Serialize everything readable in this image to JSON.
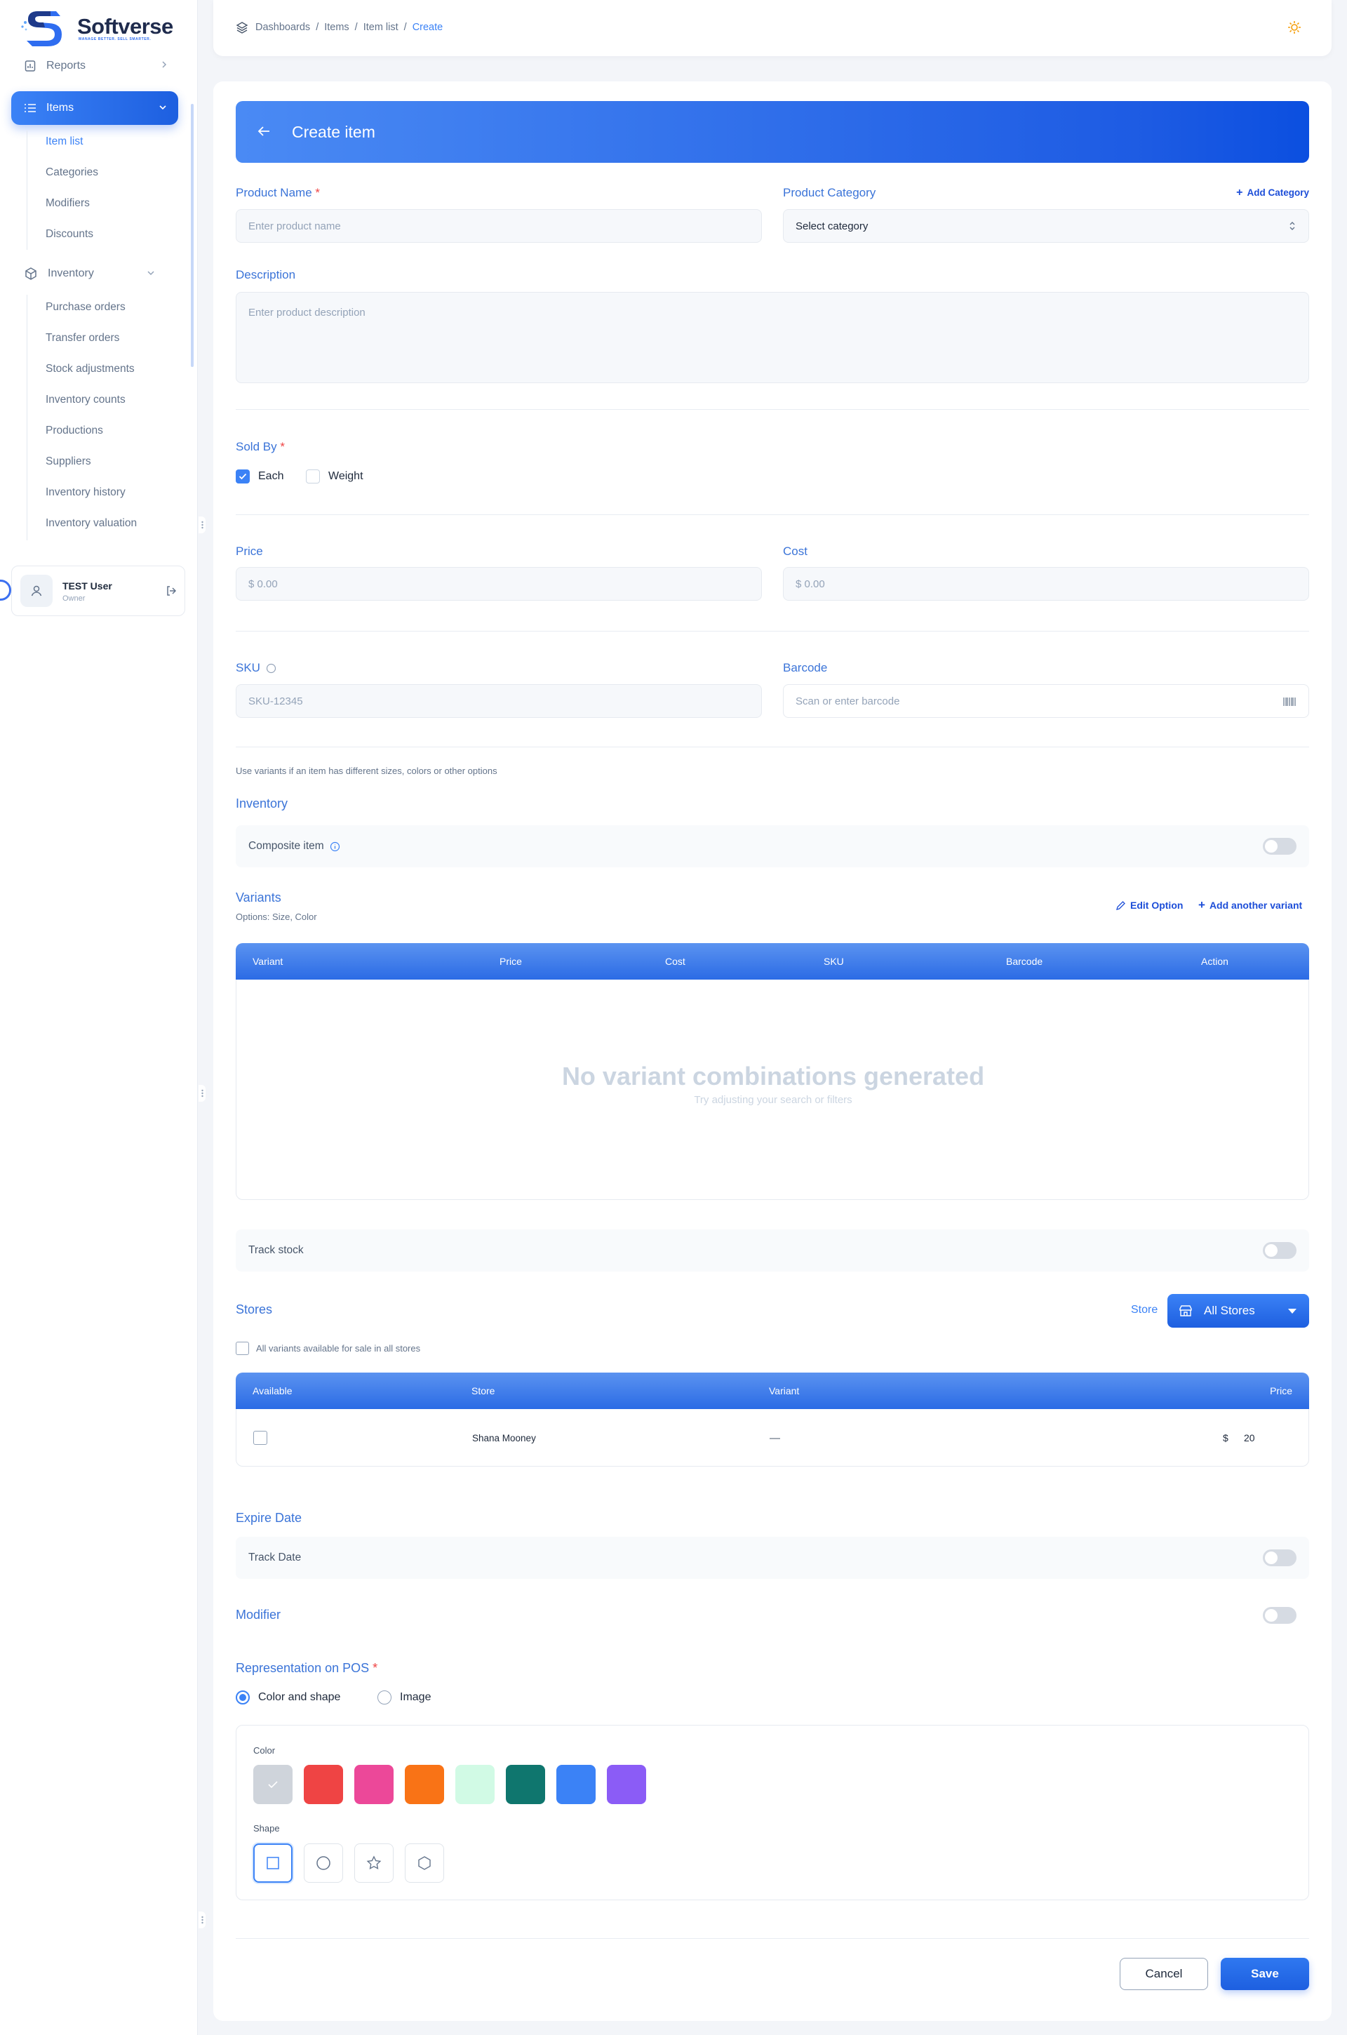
{
  "brand": {
    "name": "Softverse",
    "tagline": "MANAGE BETTER. SELL SMARTER."
  },
  "sidebar": {
    "reports": "Reports",
    "items": "Items",
    "items_sub": [
      "Item list",
      "Categories",
      "Modifiers",
      "Discounts"
    ],
    "inventory": "Inventory",
    "inventory_sub": [
      "Purchase orders",
      "Transfer orders",
      "Stock adjustments",
      "Inventory counts",
      "Productions",
      "Suppliers",
      "Inventory history",
      "Inventory valuation"
    ],
    "user": {
      "name": "TEST User",
      "role": "Owner"
    }
  },
  "breadcrumb": [
    "Dashboards",
    "Items",
    "Item list",
    "Create"
  ],
  "page_title": "Create item",
  "form": {
    "product_name": {
      "label": "Product Name",
      "placeholder": "Enter product name"
    },
    "product_category": {
      "label": "Product Category",
      "value": "Select category",
      "add_link": "Add Category"
    },
    "description": {
      "label": "Description",
      "placeholder": "Enter product description"
    },
    "sold_by": {
      "label": "Sold By",
      "each": "Each",
      "weight": "Weight",
      "each_checked": true,
      "weight_checked": false
    },
    "price": {
      "label": "Price",
      "placeholder": "$ 0.00"
    },
    "cost": {
      "label": "Cost",
      "placeholder": "$ 0.00"
    },
    "sku": {
      "label": "SKU",
      "placeholder": "SKU-12345"
    },
    "barcode": {
      "label": "Barcode",
      "placeholder": "Scan or enter barcode"
    },
    "variants_hint": "Use variants if an item has different sizes, colors or other options",
    "inventory_title": "Inventory",
    "composite_item": "Composite item",
    "variants": {
      "title": "Variants",
      "options": "Options: Size, Color",
      "edit_option": "Edit Option",
      "add_variant": "Add another variant",
      "columns": [
        "Variant",
        "Price",
        "Cost",
        "SKU",
        "Barcode",
        "Action"
      ],
      "empty_title": "No variant combinations generated",
      "empty_sub": "Try adjusting your search or filters"
    },
    "track_stock": "Track stock",
    "stores": {
      "title": "Stores",
      "store_label": "Store",
      "store_button": "All Stores",
      "all_available": "All variants available for sale in all stores",
      "columns": [
        "Available",
        "Store",
        "Variant",
        "Price"
      ],
      "rows": [
        {
          "store": "Shana Mooney",
          "variant": "—",
          "currency": "$",
          "price": "20"
        }
      ]
    },
    "expire_date": {
      "title": "Expire Date",
      "track_date": "Track Date"
    },
    "modifier": "Modifier",
    "representation": {
      "title": "Representation on POS",
      "color_and_shape": "Color and shape",
      "image": "Image",
      "color_label": "Color",
      "shape_label": "Shape",
      "colors": [
        "#cfd4db",
        "#ef4444",
        "#ec4899",
        "#f97316",
        "#d1fae5",
        "#0f766e",
        "#3b82f6",
        "#8b5cf6"
      ],
      "shapes": [
        "square-icon",
        "circle-icon",
        "star-icon",
        "hexagon-icon"
      ]
    },
    "cancel": "Cancel",
    "save": "Save"
  }
}
